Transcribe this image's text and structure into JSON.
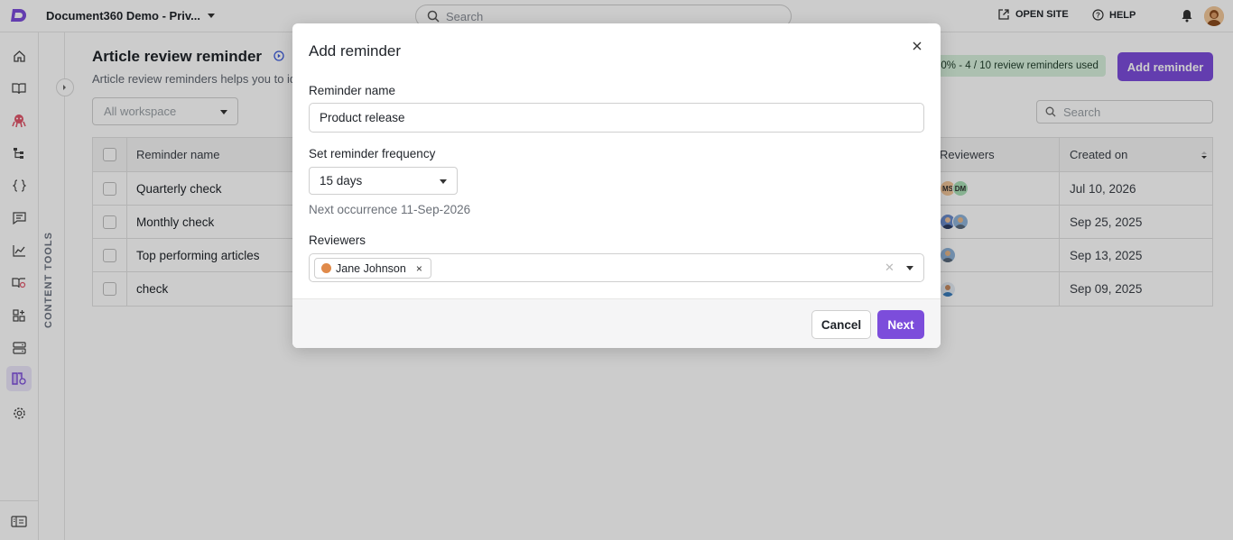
{
  "topbar": {
    "project_name": "Document360 Demo - Priv...",
    "search_placeholder": "Search",
    "open_site": "OPEN SITE",
    "help": "HELP"
  },
  "sidebar": {
    "items": [
      {
        "icon": "home-icon"
      },
      {
        "icon": "book-icon"
      },
      {
        "icon": "octopus-icon"
      },
      {
        "icon": "hierarchy-icon"
      },
      {
        "icon": "api-braces-icon"
      },
      {
        "icon": "feedback-icon"
      },
      {
        "icon": "analytics-icon"
      },
      {
        "icon": "knowledge-base-icon"
      },
      {
        "icon": "widgets-icon"
      },
      {
        "icon": "drive-icon"
      },
      {
        "icon": "content-tools-icon",
        "active": true
      },
      {
        "icon": "settings-icon"
      }
    ],
    "collapse_icon": "panel-toggle-icon",
    "accent": "#7c4ddb"
  },
  "tools_strip": {
    "label": "CONTENT TOOLS"
  },
  "main": {
    "title": "Article review reminder",
    "subtitle": "Article review reminders helps you to ide",
    "usage": "40% - 4 / 10 review reminders used",
    "add_button": "Add reminder",
    "workspace_placeholder": "All workspace",
    "search_placeholder": "Search"
  },
  "table": {
    "columns": {
      "name": "Reminder name",
      "reviewers": "Reviewers",
      "created": "Created on"
    },
    "rows": [
      {
        "name": "Quarterly check",
        "reviewers": [
          "MS",
          "DM"
        ],
        "created": "Jul 10, 2026"
      },
      {
        "name": "Monthly check",
        "reviewers": [
          "avatar",
          "avatar"
        ],
        "created": "Sep 25, 2025"
      },
      {
        "name": "Top performing articles",
        "reviewers": [
          "avatar"
        ],
        "created": "Sep 13, 2025"
      },
      {
        "name": "check",
        "reviewers": [
          "avatar"
        ],
        "created": "Sep 09, 2025"
      }
    ]
  },
  "modal": {
    "title": "Add reminder",
    "name_label": "Reminder name",
    "name_value": "Product release",
    "frequency_label": "Set reminder frequency",
    "frequency_value": "15 days",
    "next_occurrence": "Next occurrence 11-Sep-2026",
    "reviewers_label": "Reviewers",
    "reviewers": [
      {
        "name": "Jane Johnson"
      }
    ],
    "cancel": "Cancel",
    "next": "Next"
  },
  "colors": {
    "primary": "#7c4ddb",
    "usage_badge_bg": "#d8f0dd"
  }
}
